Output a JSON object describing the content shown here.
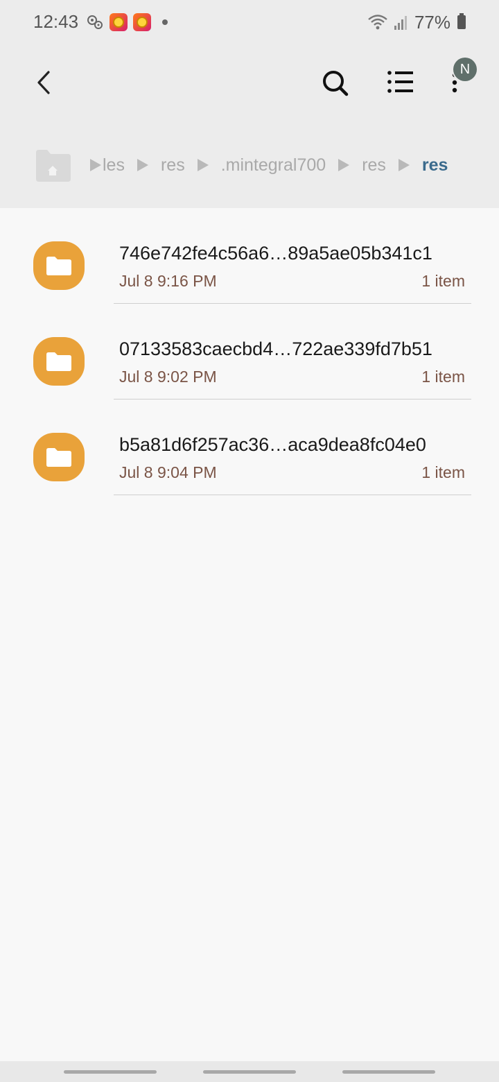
{
  "status_bar": {
    "time": "12:43",
    "battery": "77%",
    "notification_icons": [
      "settings-icon",
      "coin-game-app-icon",
      "coin-game-app-icon",
      "notification-dot-icon"
    ],
    "right_icons": [
      "wifi-icon",
      "signal-icon",
      "battery-icon"
    ]
  },
  "app_bar": {
    "avatar_initial": "N",
    "actions": [
      "back-icon",
      "search-icon",
      "list-view-icon",
      "more-options-icon"
    ]
  },
  "breadcrumb": {
    "items": [
      "les",
      "res",
      ".mintegral700",
      "res",
      "res"
    ],
    "current_index": 4
  },
  "files": [
    {
      "name": "746e742fe4c56a6…89a5ae05b341c1",
      "date": "Jul 8 9:16 PM",
      "count": "1 item"
    },
    {
      "name": "07133583caecbd4…722ae339fd7b51",
      "date": "Jul 8 9:02 PM",
      "count": "1 item"
    },
    {
      "name": "b5a81d6f257ac36…aca9dea8fc04e0",
      "date": "Jul 8 9:04 PM",
      "count": "1 item"
    }
  ],
  "colors": {
    "header_bg": "#ececec",
    "body_bg": "#f8f8f8",
    "folder": "#e9a23a",
    "breadcrumb_current": "#3a6a8c",
    "meta_text": "#7a5446"
  }
}
